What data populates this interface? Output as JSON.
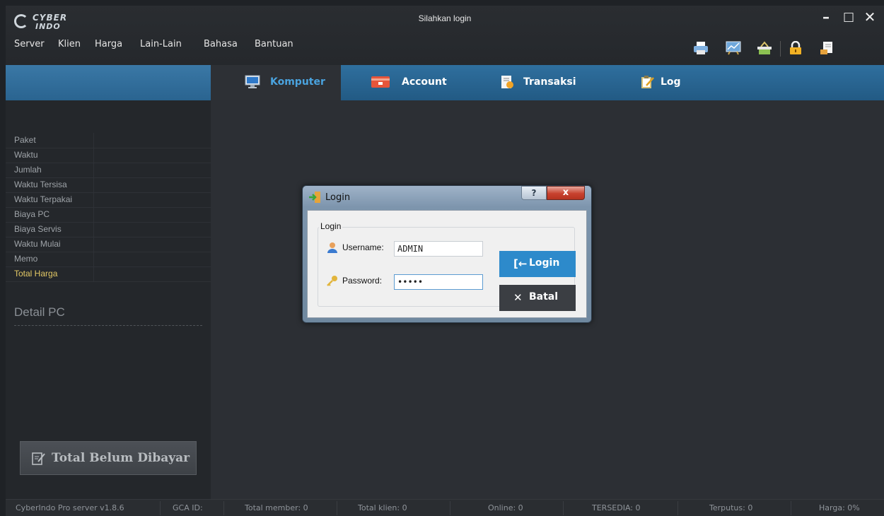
{
  "window": {
    "title": "Silahkan login",
    "logo_line1": "CYBER",
    "logo_line2": "INDO",
    "controls": [
      "–",
      "□",
      "✕"
    ]
  },
  "menu": [
    "Server",
    "Klien",
    "Harga",
    "Lain-Lain",
    "Bahasa",
    "Bantuan"
  ],
  "toolbar_icons": [
    "printer-icon",
    "chart-icon",
    "basket-icon",
    "lock-icon",
    "document-icon"
  ],
  "tabs": [
    {
      "label": "Komputer",
      "icon": "monitor-icon",
      "active": true
    },
    {
      "label": "Account",
      "icon": "card-icon",
      "active": false
    },
    {
      "label": "Transaksi",
      "icon": "receipt-icon",
      "active": false
    },
    {
      "label": "Log",
      "icon": "clipboard-icon",
      "active": false
    }
  ],
  "sidebar": {
    "fields": [
      "Paket",
      "Waktu",
      "Jumlah",
      "Waktu Tersisa",
      "Waktu Terpakai",
      "Biaya PC",
      "Biaya Servis",
      "Waktu Mulai",
      "Memo",
      "Total Harga"
    ],
    "detail_title": "Detail PC",
    "unpaid_button": "Total Belum Dibayar"
  },
  "dialog": {
    "title": "Login",
    "help": "?",
    "close": "x",
    "group_label": "Login",
    "username_label": "Username:",
    "username_value": "ADMIN",
    "password_label": "Password:",
    "password_value": "•••••",
    "login_button": "Login",
    "cancel_button": "Batal"
  },
  "status": [
    "CyberIndo Pro server v1.8.6",
    "GCA ID:",
    "Total member: 0",
    "Total klien: 0",
    "Online: 0",
    "TERSEDIA: 0",
    "Terputus: 0",
    "Harga: 0%"
  ],
  "colors": {
    "accent": "#2d8acb",
    "tab_active_text": "#4aa3df",
    "highlight_field": "#e3c865"
  }
}
